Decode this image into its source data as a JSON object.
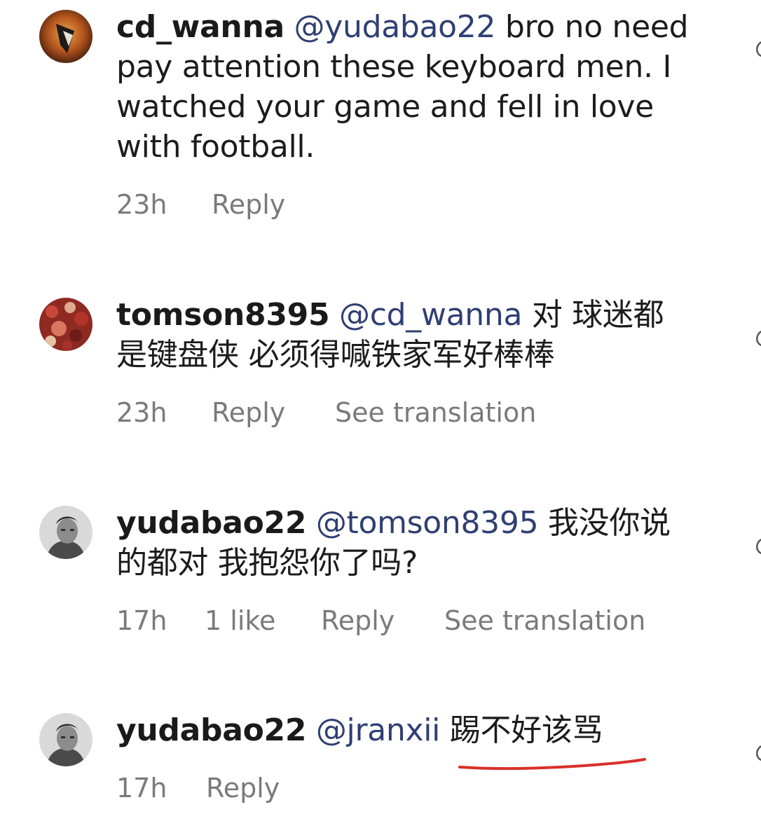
{
  "comments": [
    {
      "username": "cd_wanna",
      "mention": "@yudabao22",
      "text": "bro no need pay attention these keyboard men. I watched your game and fell in love with football.",
      "time": "23h",
      "reply": "Reply"
    },
    {
      "username": "tomson8395",
      "mention": "@cd_wanna",
      "text": "对  球迷都是键盘侠  必须得喊铁家军好棒棒",
      "time": "23h",
      "reply": "Reply",
      "translate": "See translation"
    },
    {
      "username": "yudabao22",
      "mention": "@tomson8395",
      "text": "我没你说的都对 我抱怨你了吗?",
      "time": "17h",
      "likes": "1 like",
      "reply": "Reply",
      "translate": "See translation"
    },
    {
      "username": "yudabao22",
      "mention": "@jranxii",
      "text": "踢不好该骂",
      "time": "17h",
      "reply": "Reply"
    }
  ],
  "icons": {
    "like": "heart-icon"
  },
  "colors": {
    "background": "#ffffff",
    "text": "#1c1c1c",
    "mention": "#2f3f73",
    "meta": "#7a7a7a",
    "underline": "#d9302a"
  }
}
